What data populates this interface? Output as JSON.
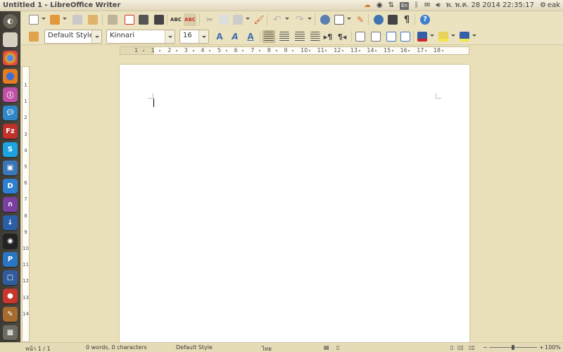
{
  "window": {
    "title": "Untitled 1 - LibreOffice Writer"
  },
  "panel": {
    "keyboard_layout": "En",
    "clock": "พ. พ.ค. 28 2014 22:35:17",
    "user": "eak"
  },
  "format_toolbar": {
    "paragraph_style": "Default Style",
    "font_name": "Kinnari",
    "font_size": "16"
  },
  "ruler": {
    "horizontal_labels": [
      "1",
      "1",
      "2",
      "3",
      "4",
      "5",
      "6",
      "7",
      "8",
      "9",
      "10",
      "11",
      "12",
      "13",
      "14",
      "15",
      "16",
      "17",
      "18"
    ],
    "vertical_labels": [
      "1",
      "1",
      "2",
      "3",
      "4",
      "5",
      "6",
      "7",
      "8",
      "9",
      "10",
      "11",
      "12",
      "13",
      "14"
    ]
  },
  "status": {
    "page": "หน้า 1 / 1",
    "word_count": "0 words, 0 characters",
    "page_style": "Default Style",
    "language": "ไทย",
    "zoom_percent": "100%",
    "zoom_minus": "−",
    "zoom_plus": "+",
    "zoom_level": 0.5
  },
  "colors": {
    "launcher_bg": "#3d3a34",
    "toolbar_bg": "#ebe2c0",
    "accent_orange": "#e06a2c"
  }
}
